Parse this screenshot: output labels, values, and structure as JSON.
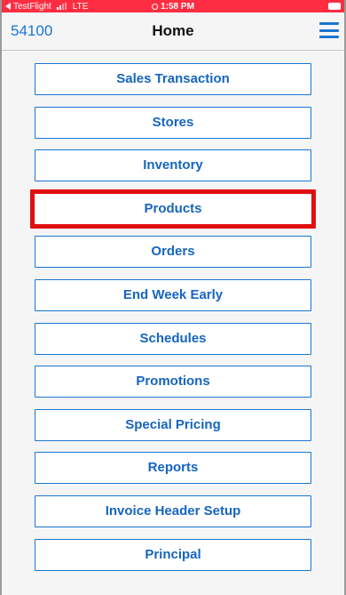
{
  "status_bar": {
    "back_app": "TestFlight",
    "network": "LTE",
    "time": "1:58 PM",
    "bg_color": "#ff2d42"
  },
  "nav": {
    "store_id": "54100",
    "title": "Home",
    "menu_icon": "hamburger-menu-icon",
    "accent_color": "#1976d2"
  },
  "menu": {
    "items": [
      {
        "label": "Sales Transaction",
        "highlighted": false
      },
      {
        "label": "Stores",
        "highlighted": false
      },
      {
        "label": "Inventory",
        "highlighted": false
      },
      {
        "label": "Products",
        "highlighted": true
      },
      {
        "label": "Orders",
        "highlighted": false
      },
      {
        "label": "End Week Early",
        "highlighted": false
      },
      {
        "label": "Schedules",
        "highlighted": false
      },
      {
        "label": "Promotions",
        "highlighted": false
      },
      {
        "label": "Special Pricing",
        "highlighted": false
      },
      {
        "label": "Reports",
        "highlighted": false
      },
      {
        "label": "Invoice Header Setup",
        "highlighted": false
      },
      {
        "label": "Principal",
        "highlighted": false
      }
    ],
    "highlight_color": "#e01010"
  }
}
